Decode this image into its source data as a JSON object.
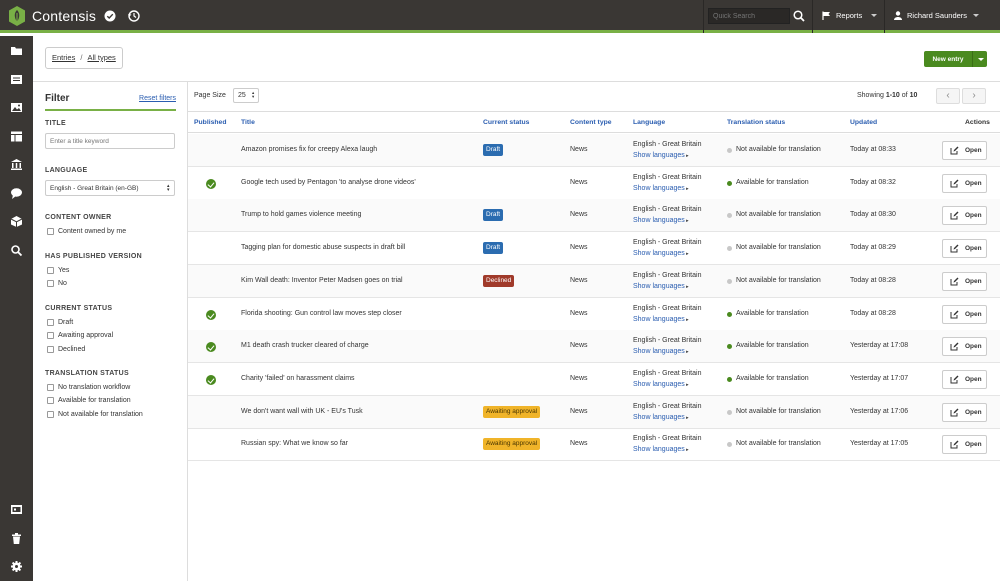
{
  "app": {
    "name": "Contensis"
  },
  "topbar": {
    "search_placeholder": "Quick Search",
    "reports_label": "Reports",
    "user_name": "Richard Saunders"
  },
  "breadcrumb": {
    "entries": "Entries",
    "separator": "/",
    "all_types": "All types"
  },
  "new_entry_label": "New entry",
  "filter": {
    "title": "Filter",
    "reset": "Reset filters",
    "title_label": "TITLE",
    "title_placeholder": "Enter a title keyword",
    "language_label": "LANGUAGE",
    "language_value": "English - Great Britain (en-GB)",
    "owner_label": "CONTENT OWNER",
    "owner_option": "Content owned by me",
    "published_label": "HAS PUBLISHED VERSION",
    "published_options": [
      "Yes",
      "No"
    ],
    "status_label": "CURRENT STATUS",
    "status_options": [
      "Draft",
      "Awaiting approval",
      "Declined"
    ],
    "translation_label": "TRANSLATION STATUS",
    "translation_options": [
      "No translation workflow",
      "Available for translation",
      "Not available for translation"
    ]
  },
  "results": {
    "page_size_label": "Page Size",
    "page_size": "25",
    "showing_prefix": "Showing",
    "showing_range": "1-10",
    "showing_of": "of",
    "showing_total": "10",
    "prev": "‹",
    "next": "›"
  },
  "columns": {
    "published": "Published",
    "title": "Title",
    "status": "Current status",
    "type": "Content type",
    "language": "Language",
    "translation": "Translation status",
    "updated": "Updated",
    "actions": "Actions"
  },
  "colors": {
    "accent": "#79b046",
    "draft": "#2b6cb0",
    "declined": "#a03a2a",
    "awaiting": "#f0b429",
    "available": "#4a8a1f",
    "not_available": "#c8c8c8"
  },
  "rows": [
    {
      "published": false,
      "title": "Amazon promises fix for creepy Alexa laugh",
      "status": "Draft",
      "status_kind": "draft",
      "type": "News",
      "language": "English - Great Britain",
      "show_languages": "Show languages",
      "translation": "Not available for translation",
      "translation_available": false,
      "updated": "Today at 08:33",
      "open": "Open"
    },
    {
      "published": true,
      "title": "Google tech used by Pentagon 'to analyse drone videos'",
      "status": "",
      "status_kind": "",
      "type": "News",
      "language": "English - Great Britain",
      "show_languages": "Show languages",
      "translation": "Available for translation",
      "translation_available": true,
      "updated": "Today at 08:32",
      "open": "Open"
    },
    {
      "published": false,
      "title": "Trump to hold games violence meeting",
      "status": "Draft",
      "status_kind": "draft",
      "type": "News",
      "language": "English - Great Britain",
      "show_languages": "Show languages",
      "translation": "Not available for translation",
      "translation_available": false,
      "updated": "Today at 08:30",
      "open": "Open"
    },
    {
      "published": false,
      "title": "Tagging plan for domestic abuse suspects in draft bill",
      "status": "Draft",
      "status_kind": "draft",
      "type": "News",
      "language": "English - Great Britain",
      "show_languages": "Show languages",
      "translation": "Not available for translation",
      "translation_available": false,
      "updated": "Today at 08:29",
      "open": "Open"
    },
    {
      "published": false,
      "title": "Kim Wall death: Inventor Peter Madsen goes on trial",
      "status": "Declined",
      "status_kind": "declined",
      "type": "News",
      "language": "English - Great Britain",
      "show_languages": "Show languages",
      "translation": "Not available for translation",
      "translation_available": false,
      "updated": "Today at 08:28",
      "open": "Open"
    },
    {
      "published": true,
      "title": "Florida shooting: Gun control law moves step closer",
      "status": "",
      "status_kind": "",
      "type": "News",
      "language": "English - Great Britain",
      "show_languages": "Show languages",
      "translation": "Available for translation",
      "translation_available": true,
      "updated": "Today at 08:28",
      "open": "Open"
    },
    {
      "published": true,
      "title": "M1 death crash trucker cleared of charge",
      "status": "",
      "status_kind": "",
      "type": "News",
      "language": "English - Great Britain",
      "show_languages": "Show languages",
      "translation": "Available for translation",
      "translation_available": true,
      "updated": "Yesterday at 17:08",
      "open": "Open"
    },
    {
      "published": true,
      "title": "Charity 'failed' on harassment claims",
      "status": "",
      "status_kind": "",
      "type": "News",
      "language": "English - Great Britain",
      "show_languages": "Show languages",
      "translation": "Available for translation",
      "translation_available": true,
      "updated": "Yesterday at 17:07",
      "open": "Open"
    },
    {
      "published": false,
      "title": "We don't want wall with UK - EU's Tusk",
      "status": "Awaiting approval",
      "status_kind": "awaiting",
      "type": "News",
      "language": "English - Great Britain",
      "show_languages": "Show languages",
      "translation": "Not available for translation",
      "translation_available": false,
      "updated": "Yesterday at 17:06",
      "open": "Open"
    },
    {
      "published": false,
      "title": "Russian spy: What we know so far",
      "status": "Awaiting approval",
      "status_kind": "awaiting",
      "type": "News",
      "language": "English - Great Britain",
      "show_languages": "Show languages",
      "translation": "Not available for translation",
      "translation_available": false,
      "updated": "Yesterday at 17:05",
      "open": "Open"
    }
  ]
}
